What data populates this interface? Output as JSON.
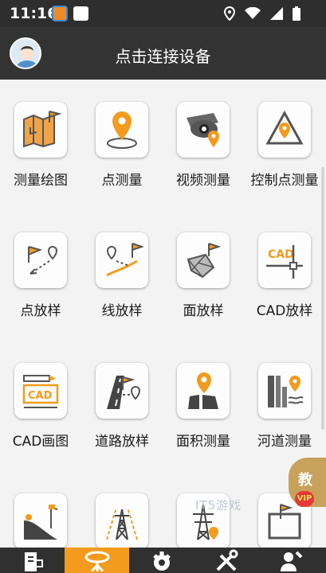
{
  "status_bar": {
    "time": "11:16",
    "icons": [
      "app-notification-icon",
      "app-notification-icon",
      "location-icon",
      "wifi-icon",
      "signal-icon",
      "battery-icon"
    ]
  },
  "header": {
    "title": "点击连接设备",
    "avatar_icon": "user-avatar-icon"
  },
  "grid": {
    "items": [
      {
        "label": "测量绘图",
        "icon": "map-survey-icon"
      },
      {
        "label": "点测量",
        "icon": "point-survey-icon"
      },
      {
        "label": "视频测量",
        "icon": "video-survey-icon"
      },
      {
        "label": "控制点测量",
        "icon": "control-point-icon"
      },
      {
        "label": "点放样",
        "icon": "point-stakeout-icon"
      },
      {
        "label": "线放样",
        "icon": "line-stakeout-icon"
      },
      {
        "label": "面放样",
        "icon": "surface-stakeout-icon"
      },
      {
        "label": "CAD放样",
        "icon": "cad-stakeout-icon"
      },
      {
        "label": "CAD画图",
        "icon": "cad-drawing-icon"
      },
      {
        "label": "道路放样",
        "icon": "road-stakeout-icon"
      },
      {
        "label": "面积测量",
        "icon": "area-survey-icon"
      },
      {
        "label": "河道测量",
        "icon": "river-survey-icon"
      },
      {
        "label": "",
        "icon": "slope-icon"
      },
      {
        "label": "",
        "icon": "tower-icon"
      },
      {
        "label": "",
        "icon": "power-tower-icon"
      },
      {
        "label": "",
        "icon": "flag-frame-icon"
      }
    ]
  },
  "floating": {
    "teach_label": "教",
    "vip_label": "VIP",
    "watermark": "IT5游戏"
  },
  "bottom_nav": {
    "tabs": [
      {
        "icon": "document-icon",
        "active": false
      },
      {
        "icon": "gnss-device-icon",
        "active": true
      },
      {
        "icon": "gear-icon",
        "active": false
      },
      {
        "icon": "tools-icon",
        "active": false
      },
      {
        "icon": "user-settings-icon",
        "active": false
      }
    ]
  },
  "colors": {
    "accent": "#f39b1d",
    "header_bg": "#333333",
    "status_bg": "#2e2e2e",
    "content_bg": "#f3f3f3"
  }
}
